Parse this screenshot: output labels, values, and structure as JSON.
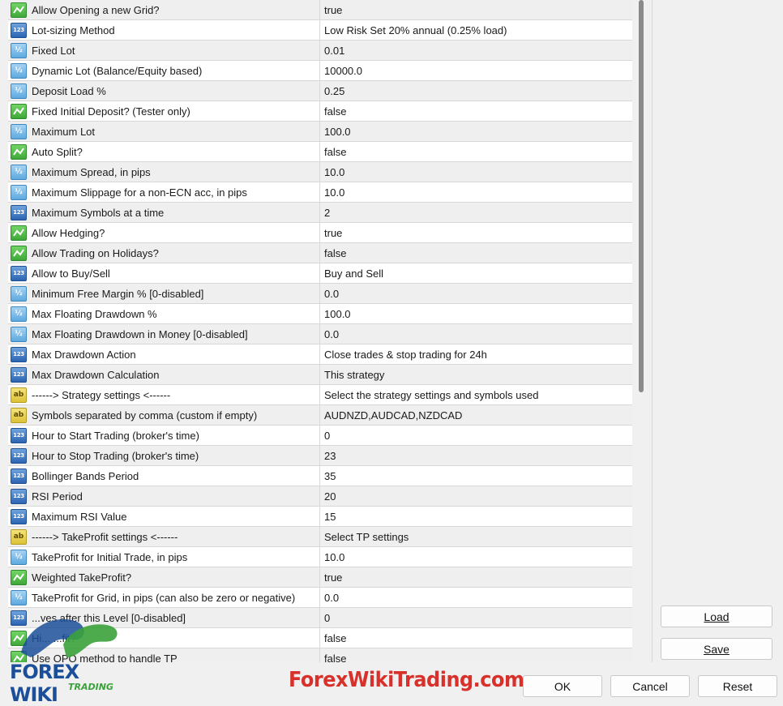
{
  "parameters": [
    {
      "type": "bool",
      "name": "Allow Opening a new Grid?",
      "value": "true"
    },
    {
      "type": "int",
      "name": "Lot-sizing Method",
      "value": "Low Risk Set 20% annual (0.25% load)"
    },
    {
      "type": "double",
      "name": "Fixed Lot",
      "value": "0.01"
    },
    {
      "type": "double",
      "name": "Dynamic Lot (Balance/Equity based)",
      "value": "10000.0"
    },
    {
      "type": "double",
      "name": "Deposit Load %",
      "value": "0.25"
    },
    {
      "type": "bool",
      "name": "Fixed Initial Deposit? (Tester only)",
      "value": "false"
    },
    {
      "type": "double",
      "name": "Maximum Lot",
      "value": "100.0"
    },
    {
      "type": "bool",
      "name": "Auto Split?",
      "value": "false"
    },
    {
      "type": "double",
      "name": "Maximum Spread, in pips",
      "value": "10.0"
    },
    {
      "type": "double",
      "name": "Maximum Slippage for a non-ECN acc, in pips",
      "value": "10.0"
    },
    {
      "type": "int",
      "name": "Maximum Symbols at a time",
      "value": "2"
    },
    {
      "type": "bool",
      "name": "Allow Hedging?",
      "value": "true"
    },
    {
      "type": "bool",
      "name": "Allow Trading on Holidays?",
      "value": "false"
    },
    {
      "type": "int",
      "name": "Allow to Buy/Sell",
      "value": "Buy and Sell"
    },
    {
      "type": "double",
      "name": "Minimum Free Margin % [0-disabled]",
      "value": "0.0"
    },
    {
      "type": "double",
      "name": "Max Floating Drawdown %",
      "value": "100.0"
    },
    {
      "type": "double",
      "name": "Max Floating Drawdown in Money [0-disabled]",
      "value": "0.0"
    },
    {
      "type": "int",
      "name": "Max Drawdown Action",
      "value": "Close trades & stop trading for 24h"
    },
    {
      "type": "int",
      "name": "Max Drawdown Calculation",
      "value": "This strategy"
    },
    {
      "type": "string",
      "name": "------> Strategy settings <------",
      "value": "Select the strategy settings and symbols used"
    },
    {
      "type": "string",
      "name": "Symbols separated by comma (custom if empty)",
      "value": "AUDNZD,AUDCAD,NZDCAD"
    },
    {
      "type": "int",
      "name": "Hour to Start Trading (broker's time)",
      "value": "0"
    },
    {
      "type": "int",
      "name": "Hour to Stop Trading (broker's time)",
      "value": "23"
    },
    {
      "type": "int",
      "name": "Bollinger Bands Period",
      "value": "35"
    },
    {
      "type": "int",
      "name": "RSI Period",
      "value": "20"
    },
    {
      "type": "int",
      "name": "Maximum RSI Value",
      "value": "15"
    },
    {
      "type": "string",
      "name": "------> TakeProfit settings <------",
      "value": "Select TP settings"
    },
    {
      "type": "double",
      "name": "TakeProfit for Initial Trade, in pips",
      "value": "10.0"
    },
    {
      "type": "bool",
      "name": "Weighted TakeProfit?",
      "value": "true"
    },
    {
      "type": "double",
      "name": "TakeProfit for Grid, in pips (can also be zero or negative)",
      "value": "0.0"
    },
    {
      "type": "int",
      "name": "...ves after this Level [0-disabled]",
      "value": "0"
    },
    {
      "type": "bool",
      "name": "Hi... ...fit?",
      "value": "false"
    },
    {
      "type": "bool",
      "name": "Use OPO method to handle TP",
      "value": "false"
    }
  ],
  "type_icons": {
    "bool": "checkmark-icon",
    "int": "123",
    "double": "½",
    "string": "ab"
  },
  "buttons": {
    "load": "Load",
    "save": "Save",
    "ok": "OK",
    "cancel": "Cancel",
    "reset": "Reset"
  },
  "watermark": {
    "text": "ForexWikiTrading.com",
    "logo_word": "FOREX WIKI",
    "logo_sub": "TRADING"
  },
  "colors": {
    "row_alt": "#efefef",
    "watermark": "#d8302a",
    "logo_blue": "#1b4f9a",
    "logo_green": "#3aa23b"
  }
}
